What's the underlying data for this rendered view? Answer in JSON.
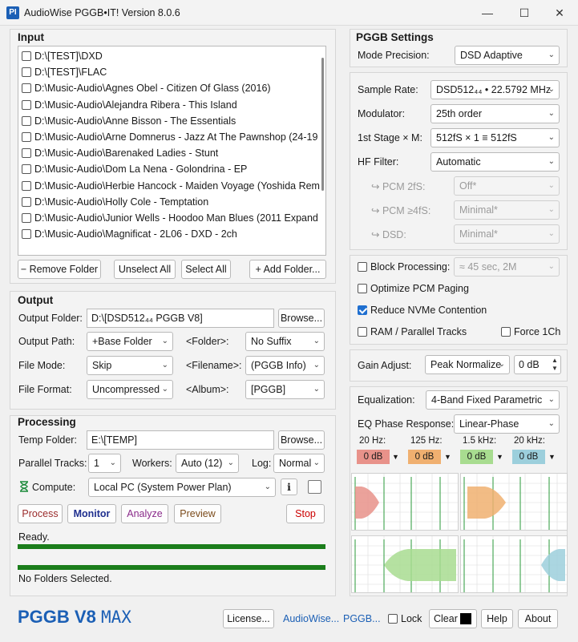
{
  "window": {
    "title": "AudioWise PGGB•IT! Version 8.0.6",
    "app_icon": "PI",
    "controls": {
      "minimize": "—",
      "maximize": "☐",
      "close": "✕"
    }
  },
  "input": {
    "heading": "Input",
    "folders": [
      {
        "path": "D:\\[TEST]\\DXD",
        "checked": false
      },
      {
        "path": "D:\\[TEST]\\FLAC",
        "checked": false
      },
      {
        "path": "D:\\Music-Audio\\Agnes Obel - Citizen Of Glass (2016)",
        "checked": false
      },
      {
        "path": "D:\\Music-Audio\\Alejandra Ribera - This Island",
        "checked": false
      },
      {
        "path": "D:\\Music-Audio\\Anne Bisson - The Essentials",
        "checked": false
      },
      {
        "path": "D:\\Music-Audio\\Arne Domnerus - Jazz At The Pawnshop (24-19",
        "checked": false
      },
      {
        "path": "D:\\Music-Audio\\Barenaked Ladies - Stunt",
        "checked": false
      },
      {
        "path": "D:\\Music-Audio\\Dom La Nena - Golondrina - EP",
        "checked": false
      },
      {
        "path": "D:\\Music-Audio\\Herbie Hancock - Maiden Voyage (Yoshida Rem",
        "checked": false
      },
      {
        "path": "D:\\Music-Audio\\Holly Cole - Temptation",
        "checked": false
      },
      {
        "path": "D:\\Music-Audio\\Junior Wells - Hoodoo Man Blues (2011 Expand",
        "checked": false
      },
      {
        "path": "D:\\Music-Audio\\Magnificat - 2L06 - DXD - 2ch",
        "checked": false
      }
    ],
    "remove_folder": "− Remove Folder",
    "unselect_all": "Unselect All",
    "select_all": "Select All",
    "add_folder": "+ Add Folder..."
  },
  "output": {
    "heading": "Output",
    "output_folder_label": "Output Folder:",
    "output_folder_value": "D:\\[DSD512₄₄ PGGB V8]",
    "browse": "Browse...",
    "output_path_label": "Output Path:",
    "output_path_value": "+Base Folder",
    "folder_label": "<Folder>:",
    "folder_value": "No Suffix",
    "file_mode_label": "File Mode:",
    "file_mode_value": "Skip",
    "filename_label": "<Filename>:",
    "filename_value": "(PGGB Info)",
    "file_format_label": "File Format:",
    "file_format_value": "Uncompressed",
    "album_label": "<Album>:",
    "album_value": "[PGGB]"
  },
  "processing": {
    "heading": "Processing",
    "temp_folder_label": "Temp Folder:",
    "temp_folder_value": "E:\\[TEMP]",
    "browse": "Browse...",
    "parallel_tracks_label": "Parallel Tracks:",
    "parallel_tracks_value": "1",
    "workers_label": "Workers:",
    "workers_value": "Auto (12)",
    "log_label": "Log:",
    "log_value": "Normal",
    "compute_label": "Compute:",
    "compute_value": "Local PC (System Power Plan)",
    "info_button": "i",
    "process": "Process",
    "monitor": "Monitor",
    "analyze": "Analyze",
    "preview": "Preview",
    "stop": "Stop",
    "status_top": "Ready.",
    "status_bottom": "No Folders Selected.",
    "progress_top": 1.0,
    "progress_bottom": 1.0,
    "colors": {
      "process": "#9b2c2c",
      "monitor": "#1f2f8f",
      "analyze": "#8a2a8a",
      "preview": "#7a4a1a",
      "stop": "#cc0000",
      "progress": "#1b7d1b"
    }
  },
  "pggb": {
    "heading": "PGGB Settings",
    "mode_precision_label": "Mode Precision:",
    "mode_precision_value": "DSD Adaptive",
    "sample_rate_label": "Sample Rate:",
    "sample_rate_value": "DSD512₄₄ • 22.5792 MHz",
    "modulator_label": "Modulator:",
    "modulator_value": "25th order",
    "first_stage_label": "1st Stage × M:",
    "first_stage_value": "512fS × 1 ≡ 512fS",
    "hf_filter_label": "HF Filter:",
    "hf_filter_value": "Automatic",
    "pcm2_label": "↪ PCM 2fS:",
    "pcm2_value": "Off*",
    "pcm4_label": "↪ PCM ≥4fS:",
    "pcm4_value": "Minimal*",
    "dsd_label": "↪ DSD:",
    "dsd_value": "Minimal*",
    "block_processing_label": "Block Processing:",
    "block_processing_checked": false,
    "block_processing_value": "≈ 45 sec, 2M",
    "optimize_pcm_label": "Optimize PCM Paging",
    "optimize_pcm_checked": false,
    "reduce_nvme_label": "Reduce NVMe Contention",
    "reduce_nvme_checked": true,
    "ram_parallel_label": "RAM / Parallel Tracks",
    "ram_parallel_checked": false,
    "force_1ch_label": "Force 1Ch",
    "force_1ch_checked": false,
    "gain_adjust_label": "Gain Adjust:",
    "gain_adjust_value": "Peak Normalize",
    "gain_db": "0 dB",
    "equalization_label": "Equalization:",
    "equalization_value": "4-Band Fixed Parametric",
    "eq_phase_label": "EQ Phase Response:",
    "eq_phase_value": "Linear-Phase",
    "bands": [
      {
        "freq": "20 Hz:",
        "gain": "0 dB",
        "color": "#e8928a"
      },
      {
        "freq": "125 Hz:",
        "gain": "0 dB",
        "color": "#f0b070"
      },
      {
        "freq": "1.5 kHz:",
        "gain": "0 dB",
        "color": "#a8dc90"
      },
      {
        "freq": "20 kHz:",
        "gain": "0 dB",
        "color": "#9ccfdc"
      }
    ]
  },
  "footer": {
    "brand": "PGGB V8",
    "brand_suffix": "MAX",
    "brand_color": "#1b5fb5",
    "license": "License...",
    "audiowise_link": "AudioWise...",
    "pggb_link": "PGGB...",
    "lock_label": "Lock",
    "lock_checked": false,
    "clear": "Clear",
    "help": "Help",
    "about": "About"
  }
}
